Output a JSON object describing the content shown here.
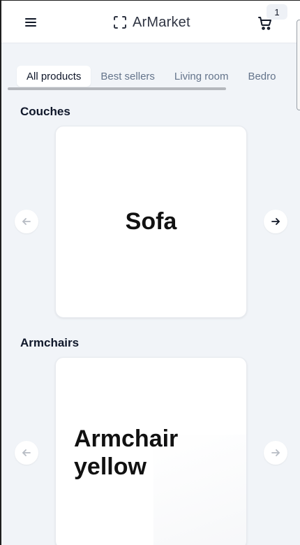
{
  "app": {
    "name": "ArMarket",
    "cart_count": "1"
  },
  "tabs": [
    {
      "label": "All products",
      "active": true
    },
    {
      "label": "Best sellers",
      "active": false
    },
    {
      "label": "Living room",
      "active": false
    },
    {
      "label": "Bedro",
      "active": false
    }
  ],
  "sections": [
    {
      "title": "Couches",
      "card_title": "Sofa"
    },
    {
      "title": "Armchairs",
      "card_title": "Armchair yellow"
    }
  ],
  "icons": {
    "menu": "menu-icon",
    "logo": "scan-icon",
    "cart": "cart-icon",
    "prev": "arrow-left-icon",
    "next": "arrow-right-icon"
  },
  "colors": {
    "background": "#f1f4f8",
    "card": "#ffffff",
    "muted_text": "#64748b",
    "text": "#0f172a"
  }
}
